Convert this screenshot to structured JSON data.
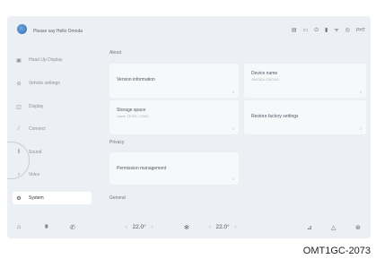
{
  "header": {
    "greeting": "Please say Hello Omoda",
    "status_icons": [
      "signal-icon",
      "screen-icon",
      "power-icon",
      "battery-icon",
      "wifi-icon",
      "location-icon"
    ],
    "status_text": "PHT"
  },
  "sidebar": {
    "items": [
      {
        "icon": "head-up-display-icon",
        "label": "Head Up Display"
      },
      {
        "icon": "vehicle-icon",
        "label": "Vehicle settings"
      },
      {
        "icon": "display-icon",
        "label": "Display"
      },
      {
        "icon": "connect-icon",
        "label": "Connect"
      },
      {
        "icon": "sound-icon",
        "label": "Sound"
      },
      {
        "icon": "voice-icon",
        "label": "Voice"
      },
      {
        "icon": "system-icon",
        "label": "System"
      }
    ],
    "active_index": 6
  },
  "main": {
    "sections": {
      "about": "About",
      "privacy": "Privacy",
      "general": "General"
    },
    "cards": {
      "version": {
        "title": "Version information"
      },
      "device_name": {
        "title": "Device name",
        "subtitle": "OMODA C5/C5/0"
      },
      "storage": {
        "title": "Storage space",
        "subtitle": "Used: 18.5G / 128G"
      },
      "factory": {
        "title": "Restore factory settings"
      },
      "permission": {
        "title": "Permission management"
      }
    }
  },
  "bottom_bar": {
    "left_temp": {
      "value": "22.0°",
      "minus": "‹",
      "plus": "›"
    },
    "right_temp": {
      "value": "22.0°",
      "minus": "‹",
      "plus": "›"
    }
  },
  "caption": "OMT1GC-2073"
}
